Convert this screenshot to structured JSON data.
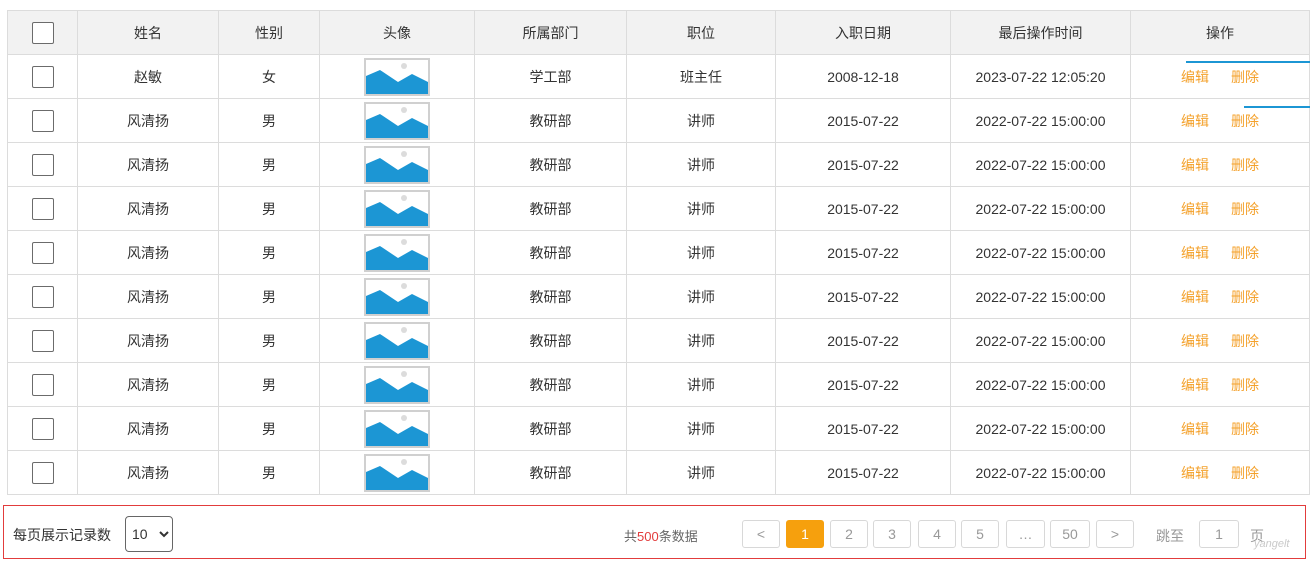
{
  "table": {
    "columns": [
      "",
      "姓名",
      "性别",
      "头像",
      "所属部门",
      "职位",
      "入职日期",
      "最后操作时间",
      "操作"
    ],
    "actions": {
      "edit": "编辑",
      "delete": "删除"
    },
    "rows": [
      {
        "name": "赵敏",
        "gender": "女",
        "dept": "学工部",
        "position": "班主任",
        "hire_date": "2008-12-18",
        "last_op": "2023-07-22 12:05:20"
      },
      {
        "name": "风清扬",
        "gender": "男",
        "dept": "教研部",
        "position": "讲师",
        "hire_date": "2015-07-22",
        "last_op": "2022-07-22 15:00:00"
      },
      {
        "name": "风清扬",
        "gender": "男",
        "dept": "教研部",
        "position": "讲师",
        "hire_date": "2015-07-22",
        "last_op": "2022-07-22 15:00:00"
      },
      {
        "name": "风清扬",
        "gender": "男",
        "dept": "教研部",
        "position": "讲师",
        "hire_date": "2015-07-22",
        "last_op": "2022-07-22 15:00:00"
      },
      {
        "name": "风清扬",
        "gender": "男",
        "dept": "教研部",
        "position": "讲师",
        "hire_date": "2015-07-22",
        "last_op": "2022-07-22 15:00:00"
      },
      {
        "name": "风清扬",
        "gender": "男",
        "dept": "教研部",
        "position": "讲师",
        "hire_date": "2015-07-22",
        "last_op": "2022-07-22 15:00:00"
      },
      {
        "name": "风清扬",
        "gender": "男",
        "dept": "教研部",
        "position": "讲师",
        "hire_date": "2015-07-22",
        "last_op": "2022-07-22 15:00:00"
      },
      {
        "name": "风清扬",
        "gender": "男",
        "dept": "教研部",
        "position": "讲师",
        "hire_date": "2015-07-22",
        "last_op": "2022-07-22 15:00:00"
      },
      {
        "name": "风清扬",
        "gender": "男",
        "dept": "教研部",
        "position": "讲师",
        "hire_date": "2015-07-22",
        "last_op": "2022-07-22 15:00:00"
      },
      {
        "name": "风清扬",
        "gender": "男",
        "dept": "教研部",
        "position": "讲师",
        "hire_date": "2015-07-22",
        "last_op": "2022-07-22 15:00:00"
      }
    ]
  },
  "pagination": {
    "per_page_label": "每页展示记录数",
    "per_page_value": "10",
    "total_prefix": "共",
    "total_count": "500",
    "total_suffix": "条数据",
    "prev": "<",
    "next": ">",
    "pages": [
      "1",
      "2",
      "3",
      "4",
      "5",
      "…",
      "50"
    ],
    "current_page": "1",
    "jump_label": "跳至",
    "jump_value": "1",
    "page_label": "页",
    "watermark": "yangelt"
  },
  "colors": {
    "action_link": "#f4a12b",
    "active_page": "#f6a00d",
    "total_highlight": "#e23c3c",
    "pager_border": "#e23c3c",
    "avatar_image": "#1c96d4"
  },
  "icons": {
    "avatar": "image-placeholder-icon",
    "checkbox": "checkbox-icon"
  }
}
